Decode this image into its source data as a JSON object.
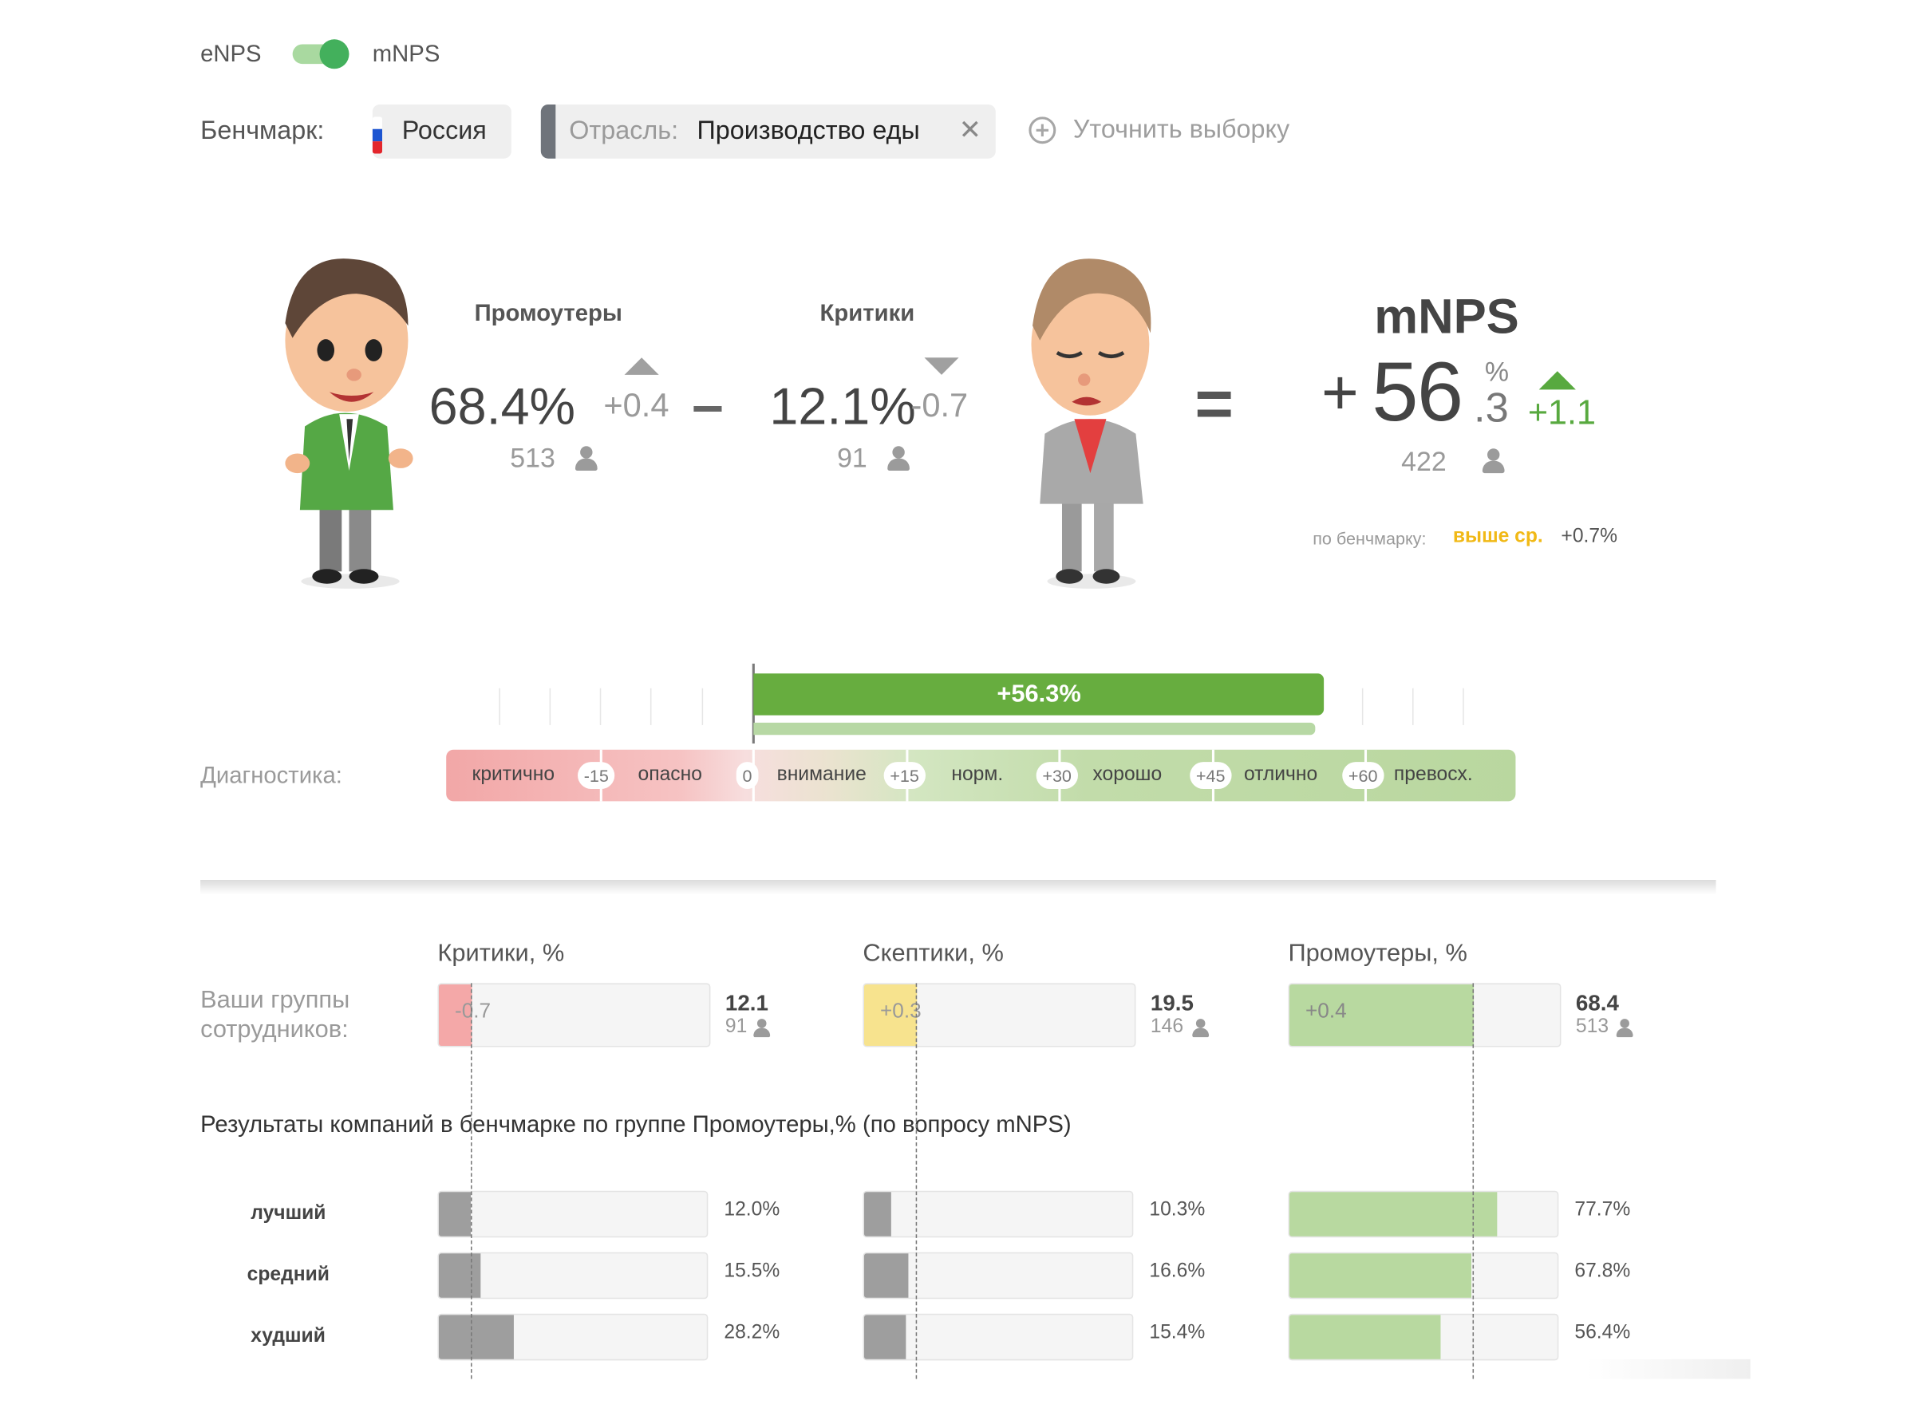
{
  "toggle": {
    "left_label": "eNPS",
    "right_label": "mNPS",
    "active": "mNPS"
  },
  "benchmark": {
    "label": "Бенчмарк:",
    "country": "Россия",
    "industry_prefix": "Отрасль:",
    "industry_value": "Производство еды",
    "refine_label": "Уточнить выборку"
  },
  "summary": {
    "promoters": {
      "title": "Промоутеры",
      "percent": "68.4%",
      "delta": "+0.4",
      "count": "513"
    },
    "minus": "–",
    "critics": {
      "title": "Критики",
      "percent": "12.1%",
      "delta": "-0.7",
      "count": "91"
    },
    "equals": "=",
    "score": {
      "title": "mNPS",
      "sign": "+",
      "int": "56",
      "decimal": ".3",
      "percent_sign": "%",
      "delta": "+1.1",
      "count": "422",
      "bench_prefix": "по бенчмарку:",
      "bench_status": "выше ср.",
      "bench_delta": "+0.7%"
    }
  },
  "diagnostics": {
    "label": "Диагностика:",
    "value_label": "+56.3%",
    "value": 56.3,
    "segments": [
      "критично",
      "опасно",
      "внимание",
      "норм.",
      "хорошо",
      "отлично",
      "превосх."
    ],
    "thresholds": [
      "-15",
      "0",
      "+15",
      "+30",
      "+45",
      "+60"
    ]
  },
  "groups": {
    "row_label": "Ваши группы сотрудников:",
    "critics": {
      "title": "Критики, %",
      "delta": "-0.7",
      "value": "12.1",
      "count": "91",
      "pct": 12.1
    },
    "skeptics": {
      "title": "Скептики, %",
      "delta": "+0.3",
      "value": "19.5",
      "count": "146",
      "pct": 19.5
    },
    "promoters": {
      "title": "Промоутеры, %",
      "delta": "+0.4",
      "value": "68.4",
      "count": "513",
      "pct": 68.4
    }
  },
  "bench_results": {
    "title": "Результаты компаний в бенчмарке по группе Промоутеры,% (по вопросу mNPS)",
    "rows": [
      "лучший",
      "средний",
      "худший"
    ],
    "critics": [
      {
        "label": "12.0%",
        "pct": 12.0
      },
      {
        "label": "15.5%",
        "pct": 15.5
      },
      {
        "label": "28.2%",
        "pct": 28.2
      }
    ],
    "skeptics": [
      {
        "label": "10.3%",
        "pct": 10.3
      },
      {
        "label": "16.6%",
        "pct": 16.6
      },
      {
        "label": "15.4%",
        "pct": 15.4
      }
    ],
    "promoters": [
      {
        "label": "77.7%",
        "pct": 77.7
      },
      {
        "label": "67.8%",
        "pct": 67.8
      },
      {
        "label": "56.4%",
        "pct": 56.4
      }
    ]
  },
  "colors": {
    "critic_fill": "#f4a8a8",
    "skeptic_fill": "#f7e38e",
    "promoter_fill": "#b8d9a0",
    "bench_gray": "#9e9e9e",
    "score_bar": "#67ad3f",
    "delta_up_green": "#58a93f",
    "above_avg": "#f1b916"
  }
}
